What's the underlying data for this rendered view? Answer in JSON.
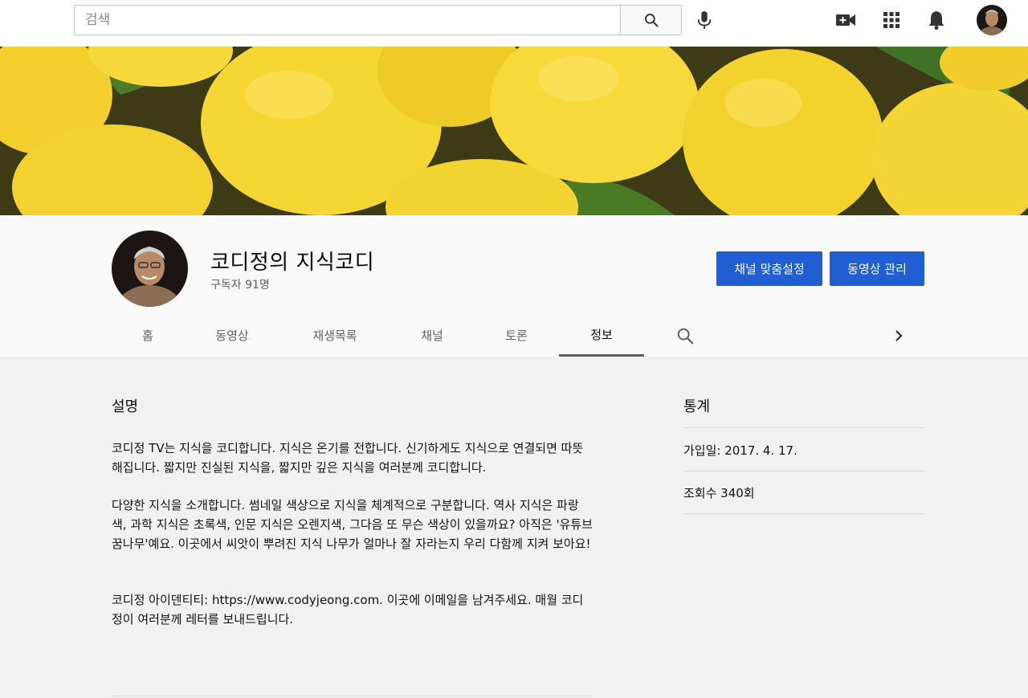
{
  "search": {
    "placeholder": "검색"
  },
  "topbar": {
    "search_icon": "search-icon",
    "mic_icon": "mic-icon",
    "create_icon": "video-create-icon",
    "apps_icon": "apps-grid-icon",
    "notifications_icon": "bell-icon"
  },
  "channel": {
    "name": "코디정의 지식코디",
    "subscribers": "구독자 91명",
    "customize_button": "채널 맞춤설정",
    "manage_button": "동영상 관리"
  },
  "tabs": [
    {
      "label": "홈"
    },
    {
      "label": "동영상"
    },
    {
      "label": "재생목록"
    },
    {
      "label": "채널"
    },
    {
      "label": "토론"
    },
    {
      "label": "정보",
      "active": true
    }
  ],
  "about": {
    "description_heading": "설명",
    "paragraphs": [
      "코디정 TV는 지식을 코디합니다. 지식은 온기를 전합니다. 신기하게도 지식으로 연결되면 따뜻해집니다. 짧지만 진실된 지식을, 짧지만 깊은 지식을 여러분께 코디합니다.",
      "다양한 지식을 소개합니다. 썸네일 색상으로 지식을 체계적으로 구분합니다. 역사 지식은 파랑색, 과학 지식은 초록색, 인문 지식은 오렌지색, 그다음 또 무슨 색상이 있을까요? 아직은 '유튜브 꿈나무'예요. 이곳에서 씨앗이 뿌려진 지식 나무가 얼마나 잘 자라는지 우리 다함께 지켜 보아요!",
      "코디정 아이덴티티: https://www.codyjeong.com. 이곳에 이메일을 남겨주세요. 매월 코디정이 여러분께 레터를 보내드립니다."
    ],
    "stats_heading": "통계",
    "joined": "가입일: 2017. 4. 17.",
    "views": "조회수 340회"
  },
  "colors": {
    "accent_blue": "#1f5fd1",
    "topbar_bg": "#ffffff",
    "header_bg": "#f9f9f9",
    "page_bg": "#f1f1f1",
    "lemon": "#f4d22e"
  }
}
